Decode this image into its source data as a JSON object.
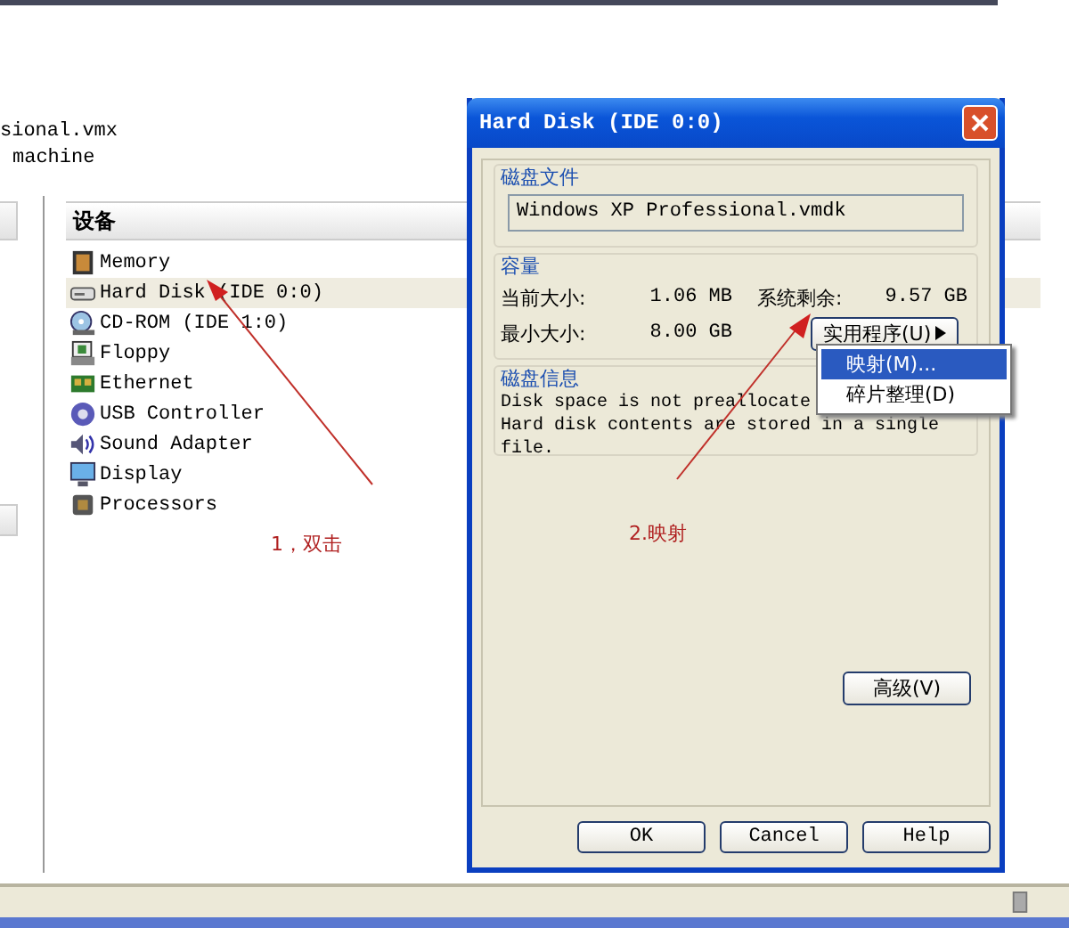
{
  "background_window": {
    "file_text": "sional.vmx",
    "machine_text": "machine"
  },
  "devices_panel": {
    "header": "设备",
    "items": [
      {
        "name": "Memory",
        "selected": false
      },
      {
        "name": "Hard Disk (IDE 0:0)",
        "selected": true
      },
      {
        "name": "CD-ROM (IDE 1:0)",
        "selected": false
      },
      {
        "name": "Floppy",
        "selected": false
      },
      {
        "name": "Ethernet",
        "selected": false
      },
      {
        "name": "USB Controller",
        "selected": false
      },
      {
        "name": "Sound Adapter",
        "selected": false
      },
      {
        "name": "Display",
        "selected": false
      },
      {
        "name": "Processors",
        "selected": false
      }
    ]
  },
  "annotations": [
    "1，双击",
    "2.映射"
  ],
  "dialog": {
    "title": "Hard Disk (IDE 0:0)",
    "disk_file": {
      "label": "磁盘文件",
      "value": "Windows XP Professional.vmdk"
    },
    "capacity": {
      "label": "容量",
      "current_size_label": "当前大小:",
      "current_size": "1.06 MB",
      "system_free_label": "系统剩余:",
      "system_free": "9.57 GB",
      "min_size_label": "最小大小:",
      "min_size": "8.00 GB",
      "utilities_button": "实用程序(U)"
    },
    "menu": [
      {
        "label": "映射(M)...",
        "selected": true
      },
      {
        "label": "碎片整理(D)",
        "selected": false
      }
    ],
    "disk_info": {
      "label": "磁盘信息",
      "line_1": "Disk space is not preallocate",
      "line_2": "Hard disk contents are stored in a single file."
    },
    "advanced_button": "高级(V)",
    "buttons": [
      "OK",
      "Cancel",
      "Help"
    ]
  }
}
